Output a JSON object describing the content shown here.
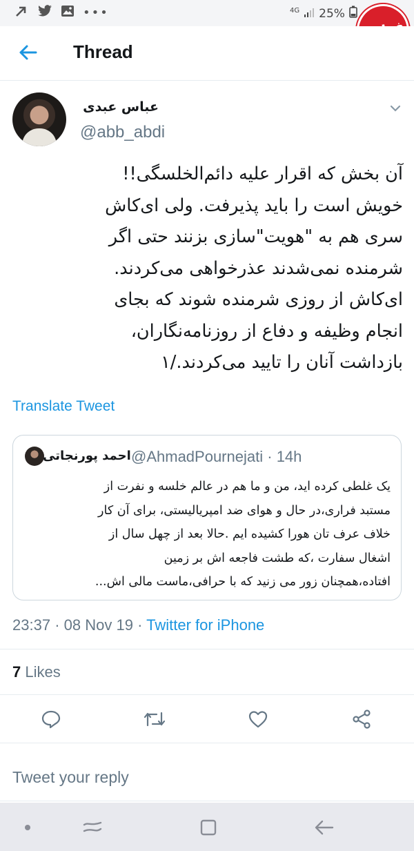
{
  "status_bar": {
    "network": "4G",
    "battery": "25%",
    "left_icons": [
      "arrow-icon",
      "twitter-bird-icon",
      "gallery-icon",
      "more-dots-icon"
    ]
  },
  "watermark": {
    "text": "فرادید"
  },
  "header": {
    "title": "Thread"
  },
  "tweet": {
    "display_name": "عباس عبدی",
    "handle": "@abb_abdi",
    "text_lines": [
      "آن بخش که اقرار علیه دائم‌الخلسگی!!",
      "خویش است را باید پذیرفت. ولی ای‌کاش",
      "سری هم به \"هویت\"سازی بزنند حتی اگر",
      "شرمنده نمی‌شدند عذرخواهی می‌کردند.",
      "ای‌کاش از روزی شرمنده شوند که بجای",
      "انجام وظیفه و دفاع از روزنامه‌نگاران،",
      "بازداشت آنان را تایید می‌کردند./۱"
    ],
    "translate_label": "Translate Tweet",
    "time": "23:37",
    "date": "08 Nov 19",
    "source": "Twitter for iPhone",
    "likes_count": "7",
    "likes_label": "Likes"
  },
  "quoted_tweet": {
    "display_name": "احمد پورنجاتی",
    "handle": "@AhmadPournejati",
    "time_ago": "14h",
    "text_lines": [
      "یک غلطی کرده اید، من و ما هم در عالم خلسه و نفرت از",
      "مستبد فراری،در حال و هوای ضد امپریالیستی، برای آن کار",
      "خلاف عرف تان هورا کشیده ایم .حالا بعد از چهل سال از",
      "اشغال سفارت ،که طشت فاجعه اش بر زمین",
      "افتاده،همچنان زور می زنید که با حرافی،ماست مالی اش..."
    ]
  },
  "reply": {
    "placeholder": "Tweet your reply"
  },
  "colors": {
    "accent": "#1b95e0",
    "secondary_text": "#657786",
    "border": "#ccd6dd",
    "nav_bar": "#e8e9ee"
  }
}
